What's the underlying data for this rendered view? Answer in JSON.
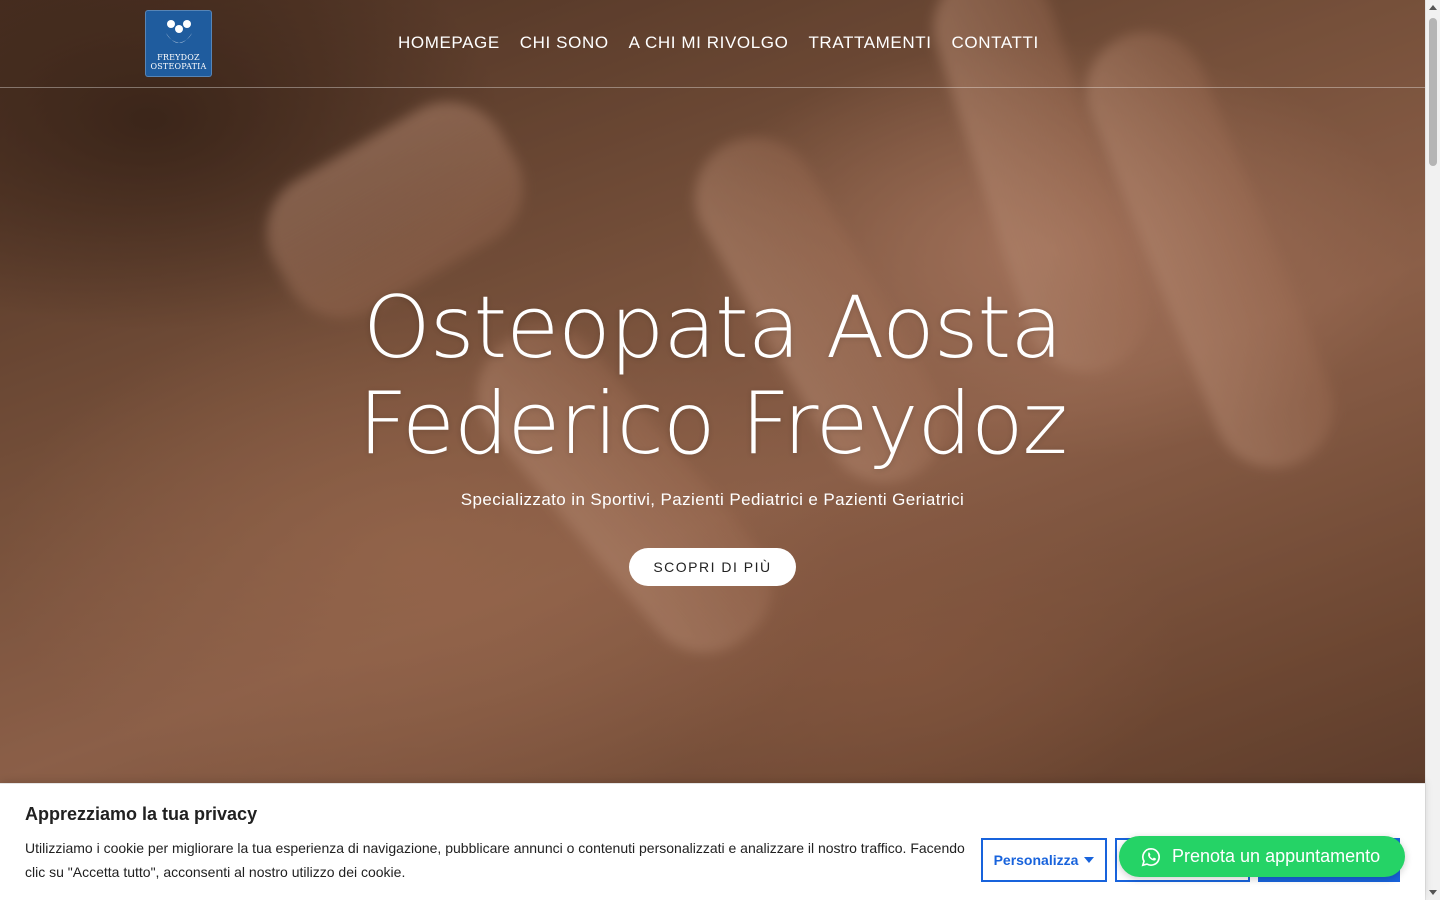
{
  "brand": {
    "logo_line1": "FREYDOZ",
    "logo_line2": "OSTEOPATIA",
    "logo_color": "#1f5c9e"
  },
  "nav": {
    "items": [
      {
        "label": "HOMEPAGE"
      },
      {
        "label": "CHI SONO"
      },
      {
        "label": "A CHI MI RIVOLGO"
      },
      {
        "label": "TRATTAMENTI"
      },
      {
        "label": "CONTATTI"
      }
    ]
  },
  "hero": {
    "title_line1": "Osteopata Aosta",
    "title_line2": "Federico Freydoz",
    "subtitle": "Specializzato in Sportivi, Pazienti Pediatrici e Pazienti Geriatrici",
    "cta_label": "SCOPRI DI PIÙ"
  },
  "cookie": {
    "title": "Apprezziamo la tua privacy",
    "text": "Utilizziamo i cookie per migliorare la tua esperienza di navigazione, pubblicare annunci o contenuti personalizzati e analizzare il nostro traffico. Facendo clic su \"Accetta tutto\", acconsenti al nostro utilizzo dei cookie.",
    "customize_label": "Personalizza",
    "accent": "#1863dc"
  },
  "whatsapp": {
    "label": "Prenota un appuntamento",
    "icon": "whatsapp-icon",
    "color": "#25d366"
  }
}
